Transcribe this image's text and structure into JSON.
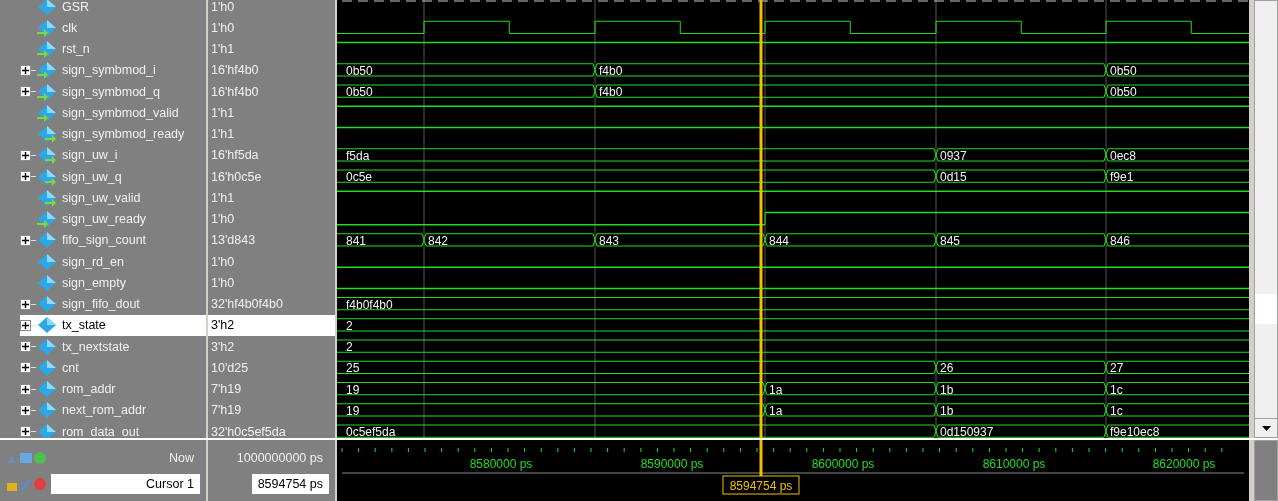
{
  "signals": [
    {
      "name": "GSR",
      "value": "1'h0",
      "input": false,
      "output": false,
      "expandable": false,
      "selected": false,
      "kind": "dashed"
    },
    {
      "name": "clk",
      "value": "1'h0",
      "input": true,
      "output": false,
      "expandable": false,
      "selected": false,
      "kind": "clock"
    },
    {
      "name": "rst_n",
      "value": "1'h1",
      "input": true,
      "output": false,
      "expandable": false,
      "selected": false,
      "kind": "bit",
      "cycles": [
        {
          "high": true
        },
        {
          "high": true
        },
        {
          "high": true
        },
        {
          "high": true
        },
        {
          "high": true
        },
        {
          "high": true
        }
      ]
    },
    {
      "name": "sign_symbmod_i",
      "value": "16'hf4b0",
      "input": true,
      "output": false,
      "expandable": true,
      "selected": false,
      "kind": "bus",
      "cycles": [
        {
          "change": true,
          "value": "0b50"
        },
        {
          "change": false
        },
        {
          "change": true,
          "value": "f4b0"
        },
        {
          "change": false
        },
        {
          "change": false
        },
        {
          "change": true,
          "value": "0b50"
        }
      ]
    },
    {
      "name": "sign_symbmod_q",
      "value": "16'hf4b0",
      "input": true,
      "output": false,
      "expandable": true,
      "selected": false,
      "kind": "bus",
      "cycles": [
        {
          "change": true,
          "value": "0b50"
        },
        {
          "change": false
        },
        {
          "change": true,
          "value": "f4b0"
        },
        {
          "change": false
        },
        {
          "change": false
        },
        {
          "change": true,
          "value": "0b50"
        }
      ]
    },
    {
      "name": "sign_symbmod_valid",
      "value": "1'h1",
      "input": true,
      "output": false,
      "expandable": false,
      "selected": false,
      "kind": "bit",
      "cycles": [
        {
          "high": true
        },
        {
          "high": true
        },
        {
          "high": true
        },
        {
          "high": true
        },
        {
          "high": true
        },
        {
          "high": true
        }
      ]
    },
    {
      "name": "sign_symbmod_ready",
      "value": "1'h1",
      "input": false,
      "output": true,
      "expandable": false,
      "selected": false,
      "kind": "bit",
      "cycles": [
        {
          "high": true
        },
        {
          "high": true
        },
        {
          "high": true
        },
        {
          "high": true
        },
        {
          "high": true
        },
        {
          "high": true
        }
      ]
    },
    {
      "name": "sign_uw_i",
      "value": "16'hf5da",
      "input": false,
      "output": true,
      "expandable": true,
      "selected": false,
      "kind": "bus",
      "cycles": [
        {
          "change": true,
          "value": "f5da"
        },
        {
          "change": false
        },
        {
          "change": false
        },
        {
          "change": false
        },
        {
          "change": true,
          "value": "0937"
        },
        {
          "change": true,
          "value": "0ec8"
        }
      ]
    },
    {
      "name": "sign_uw_q",
      "value": "16'h0c5e",
      "input": false,
      "output": true,
      "expandable": true,
      "selected": false,
      "kind": "bus",
      "cycles": [
        {
          "change": true,
          "value": "0c5e"
        },
        {
          "change": false
        },
        {
          "change": false
        },
        {
          "change": false
        },
        {
          "change": true,
          "value": "0d15"
        },
        {
          "change": true,
          "value": "f9e1"
        }
      ]
    },
    {
      "name": "sign_uw_valid",
      "value": "1'h1",
      "input": false,
      "output": true,
      "expandable": false,
      "selected": false,
      "kind": "bit",
      "cycles": [
        {
          "high": true
        },
        {
          "high": true
        },
        {
          "high": true
        },
        {
          "high": true
        },
        {
          "high": true
        },
        {
          "high": true
        }
      ]
    },
    {
      "name": "sign_uw_ready",
      "value": "1'h0",
      "input": true,
      "output": false,
      "expandable": false,
      "selected": false,
      "kind": "bit",
      "cycles": [
        {
          "high": false
        },
        {
          "high": false
        },
        {
          "high": false
        },
        {
          "high": true
        },
        {
          "high": true
        },
        {
          "high": true
        }
      ]
    },
    {
      "name": "fifo_sign_count",
      "value": "13'd843",
      "input": false,
      "output": false,
      "expandable": true,
      "selected": false,
      "kind": "bus",
      "cycles": [
        {
          "change": true,
          "value": "841"
        },
        {
          "change": true,
          "value": "842"
        },
        {
          "change": true,
          "value": "843"
        },
        {
          "change": true,
          "value": "844"
        },
        {
          "change": true,
          "value": "845"
        },
        {
          "change": true,
          "value": "846"
        }
      ]
    },
    {
      "name": "sign_rd_en",
      "value": "1'h0",
      "input": false,
      "output": false,
      "expandable": false,
      "selected": false,
      "kind": "bit",
      "cycles": [
        {
          "high": false
        },
        {
          "high": false
        },
        {
          "high": false
        },
        {
          "high": false
        },
        {
          "high": false
        },
        {
          "high": false
        }
      ]
    },
    {
      "name": "sign_empty",
      "value": "1'h0",
      "input": false,
      "output": false,
      "expandable": false,
      "selected": false,
      "kind": "bit",
      "cycles": [
        {
          "high": false
        },
        {
          "high": false
        },
        {
          "high": false
        },
        {
          "high": false
        },
        {
          "high": false
        },
        {
          "high": false
        }
      ]
    },
    {
      "name": "sign_fifo_dout",
      "value": "32'hf4b0f4b0",
      "input": false,
      "output": false,
      "expandable": true,
      "selected": false,
      "kind": "bus",
      "cycles": [
        {
          "change": true,
          "value": "f4b0f4b0"
        },
        {
          "change": false
        },
        {
          "change": false
        },
        {
          "change": false
        },
        {
          "change": false
        },
        {
          "change": false
        }
      ]
    },
    {
      "name": "tx_state",
      "value": "3'h2",
      "input": false,
      "output": false,
      "expandable": true,
      "selected": true,
      "kind": "bus",
      "cycles": [
        {
          "change": true,
          "value": "2"
        },
        {
          "change": false
        },
        {
          "change": false
        },
        {
          "change": false
        },
        {
          "change": false
        },
        {
          "change": false
        }
      ]
    },
    {
      "name": "tx_nextstate",
      "value": "3'h2",
      "input": false,
      "output": false,
      "expandable": true,
      "selected": false,
      "kind": "bus",
      "cycles": [
        {
          "change": true,
          "value": "2"
        },
        {
          "change": false
        },
        {
          "change": false
        },
        {
          "change": false
        },
        {
          "change": false
        },
        {
          "change": false
        }
      ]
    },
    {
      "name": "cnt",
      "value": "10'd25",
      "input": false,
      "output": false,
      "expandable": true,
      "selected": false,
      "kind": "bus",
      "cycles": [
        {
          "change": true,
          "value": "25"
        },
        {
          "change": false
        },
        {
          "change": false
        },
        {
          "change": false
        },
        {
          "change": true,
          "value": "26"
        },
        {
          "change": true,
          "value": "27"
        }
      ]
    },
    {
      "name": "rom_addr",
      "value": "7'h19",
      "input": false,
      "output": false,
      "expandable": true,
      "selected": false,
      "kind": "bus",
      "cycles": [
        {
          "change": true,
          "value": "19"
        },
        {
          "change": false
        },
        {
          "change": false
        },
        {
          "change": true,
          "value": "1a"
        },
        {
          "change": true,
          "value": "1b"
        },
        {
          "change": true,
          "value": "1c"
        }
      ]
    },
    {
      "name": "next_rom_addr",
      "value": "7'h19",
      "input": false,
      "output": false,
      "expandable": true,
      "selected": false,
      "kind": "bus",
      "cycles": [
        {
          "change": true,
          "value": "19"
        },
        {
          "change": false
        },
        {
          "change": false
        },
        {
          "change": true,
          "value": "1a"
        },
        {
          "change": true,
          "value": "1b"
        },
        {
          "change": true,
          "value": "1c"
        }
      ]
    },
    {
      "name": "rom_data_out",
      "value": "32'h0c5ef5da",
      "input": false,
      "output": false,
      "expandable": true,
      "selected": false,
      "kind": "bus",
      "cycles": [
        {
          "change": true,
          "value": "0c5ef5da"
        },
        {
          "change": false
        },
        {
          "change": false
        },
        {
          "change": false
        },
        {
          "change": true,
          "value": "0d150937"
        },
        {
          "change": true,
          "value": "f9e10ec8"
        }
      ]
    }
  ],
  "now": {
    "label": "Now",
    "value": "1000000000 ps"
  },
  "cursor": {
    "label": "Cursor 1",
    "value": "8594754 ps",
    "flag": "8594754 ps"
  },
  "timeline": [
    "8580000 ps",
    "8590000 ps",
    "8600000 ps",
    "8610000 ps",
    "8620000 ps"
  ]
}
